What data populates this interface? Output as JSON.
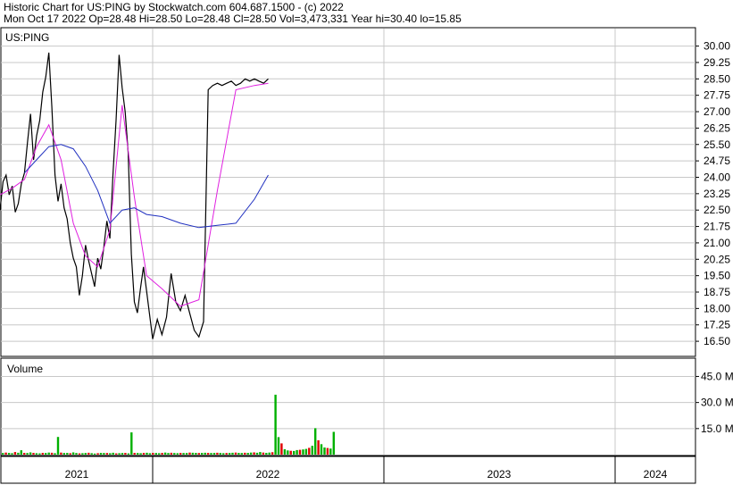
{
  "header": {
    "line1": "Historic Chart for US:PING by Stockwatch.com 604.687.1500 - (c) 2022",
    "line2": "Mon Oct 17 2022  Op=28.48  Hi=28.50  Lo=28.48  Cl=28.50  Vol=3,473,331  Year hi=30.40  lo=15.85"
  },
  "colors": {
    "price": "#000000",
    "ma_short": "#e020e0",
    "ma_long": "#2030c0",
    "grid": "#c8c8c8",
    "vol_up": "#00b000",
    "vol_down": "#e00000"
  },
  "chart_data": [
    {
      "type": "line",
      "title": "US:PING",
      "ylim": [
        15.85,
        30.8
      ],
      "y_ticks": [
        "30.00",
        "29.25",
        "28.50",
        "27.75",
        "27.00",
        "26.25",
        "25.50",
        "24.75",
        "24.00",
        "23.25",
        "22.50",
        "21.75",
        "21.00",
        "20.25",
        "19.50",
        "18.75",
        "18.00",
        "17.25",
        "16.50"
      ],
      "grid": true,
      "series": [
        {
          "name": "",
          "values": [
            [
              2021.0,
              22.5
            ],
            [
              2021.02,
              23.8
            ],
            [
              2021.04,
              24.1
            ],
            [
              2021.06,
              23.2
            ],
            [
              2021.08,
              23.6
            ],
            [
              2021.1,
              22.4
            ],
            [
              2021.12,
              22.8
            ],
            [
              2021.14,
              23.7
            ],
            [
              2021.16,
              24.2
            ],
            [
              2021.18,
              25.6
            ],
            [
              2021.2,
              26.9
            ],
            [
              2021.22,
              24.8
            ],
            [
              2021.24,
              25.9
            ],
            [
              2021.26,
              26.6
            ],
            [
              2021.28,
              27.9
            ],
            [
              2021.3,
              28.6
            ],
            [
              2021.32,
              29.7
            ],
            [
              2021.34,
              27.2
            ],
            [
              2021.36,
              24.1
            ],
            [
              2021.38,
              22.9
            ],
            [
              2021.4,
              23.7
            ],
            [
              2021.42,
              22.6
            ],
            [
              2021.44,
              22.1
            ],
            [
              2021.46,
              21.0
            ],
            [
              2021.48,
              20.3
            ],
            [
              2021.5,
              19.9
            ],
            [
              2021.52,
              18.6
            ],
            [
              2021.54,
              19.5
            ],
            [
              2021.56,
              20.9
            ],
            [
              2021.58,
              20.2
            ],
            [
              2021.6,
              19.6
            ],
            [
              2021.62,
              19.0
            ],
            [
              2021.64,
              20.3
            ],
            [
              2021.66,
              19.8
            ],
            [
              2021.68,
              20.8
            ],
            [
              2021.7,
              22.0
            ],
            [
              2021.72,
              21.2
            ],
            [
              2021.74,
              24.1
            ],
            [
              2021.76,
              26.6
            ],
            [
              2021.78,
              29.6
            ],
            [
              2021.8,
              28.1
            ],
            [
              2021.82,
              27.0
            ],
            [
              2021.84,
              25.1
            ],
            [
              2021.86,
              20.5
            ],
            [
              2021.88,
              18.3
            ],
            [
              2021.9,
              17.8
            ],
            [
              2021.92,
              18.9
            ],
            [
              2021.94,
              19.9
            ],
            [
              2021.96,
              18.8
            ],
            [
              2021.98,
              17.7
            ],
            [
              2022.0,
              16.6
            ],
            [
              2022.02,
              17.5
            ],
            [
              2022.04,
              16.8
            ],
            [
              2022.06,
              17.6
            ],
            [
              2022.08,
              19.6
            ],
            [
              2022.1,
              18.3
            ],
            [
              2022.12,
              17.9
            ],
            [
              2022.14,
              18.6
            ],
            [
              2022.16,
              17.8
            ],
            [
              2022.18,
              17.0
            ],
            [
              2022.2,
              16.7
            ],
            [
              2022.22,
              17.4
            ],
            [
              2022.24,
              28.0
            ],
            [
              2022.26,
              28.2
            ],
            [
              2022.28,
              28.3
            ],
            [
              2022.3,
              28.2
            ],
            [
              2022.32,
              28.3
            ],
            [
              2022.34,
              28.4
            ],
            [
              2022.36,
              28.2
            ],
            [
              2022.38,
              28.3
            ],
            [
              2022.4,
              28.5
            ],
            [
              2022.42,
              28.4
            ],
            [
              2022.44,
              28.5
            ],
            [
              2022.46,
              28.4
            ],
            [
              2022.48,
              28.3
            ],
            [
              2022.5,
              28.5
            ]
          ]
        },
        {
          "name": "",
          "values": [
            [
              2021.0,
              23.2
            ],
            [
              2021.08,
              23.5
            ],
            [
              2021.16,
              23.9
            ],
            [
              2021.24,
              25.4
            ],
            [
              2021.32,
              26.4
            ],
            [
              2021.4,
              24.8
            ],
            [
              2021.48,
              21.9
            ],
            [
              2021.56,
              20.4
            ],
            [
              2021.64,
              19.9
            ],
            [
              2021.72,
              21.6
            ],
            [
              2021.8,
              27.3
            ],
            [
              2021.88,
              23.1
            ],
            [
              2021.96,
              19.5
            ],
            [
              2022.04,
              18.9
            ],
            [
              2022.12,
              18.1
            ],
            [
              2022.2,
              18.4
            ],
            [
              2022.28,
              23.4
            ],
            [
              2022.36,
              28.0
            ],
            [
              2022.44,
              28.2
            ],
            [
              2022.5,
              28.3
            ]
          ]
        },
        {
          "name": "",
          "values": [
            [
              2021.16,
              24.2
            ],
            [
              2021.24,
              24.8
            ],
            [
              2021.32,
              25.4
            ],
            [
              2021.4,
              25.5
            ],
            [
              2021.48,
              25.3
            ],
            [
              2021.56,
              24.5
            ],
            [
              2021.64,
              23.4
            ],
            [
              2021.72,
              21.9
            ],
            [
              2021.8,
              22.5
            ],
            [
              2021.88,
              22.6
            ],
            [
              2021.96,
              22.3
            ],
            [
              2022.04,
              22.2
            ],
            [
              2022.12,
              21.9
            ],
            [
              2022.2,
              21.7
            ],
            [
              2022.28,
              21.8
            ],
            [
              2022.36,
              21.9
            ],
            [
              2022.44,
              23.0
            ],
            [
              2022.5,
              24.1
            ]
          ]
        }
      ]
    },
    {
      "type": "bar",
      "title": "Volume",
      "ylim": [
        0,
        55
      ],
      "y_ticks": [
        "45.0 M",
        "30.0 M",
        "15.0 M"
      ],
      "values": [
        0.9,
        1.2,
        1.0,
        0.8,
        1.5,
        1.1,
        2.5,
        1.0,
        0.9,
        1.3,
        1.0,
        0.8,
        0.7,
        1.0,
        0.9,
        1.2,
        1.1,
        0.8,
        10.2,
        1.2,
        0.9,
        1.0,
        0.8,
        1.3,
        0.9,
        0.7,
        0.8,
        0.9,
        1.1,
        0.8,
        0.6,
        0.8,
        1.0,
        0.9,
        0.9,
        0.8,
        1.1,
        0.7,
        0.8,
        0.9,
        1.0,
        0.7,
        12.8,
        1.0,
        0.9,
        0.8,
        1.0,
        1.1,
        0.8,
        1.0,
        0.9,
        0.8,
        1.0,
        1.2,
        0.9,
        1.1,
        0.9,
        0.8,
        1.0,
        0.9,
        0.9,
        1.2,
        1.1,
        1.0,
        0.9,
        1.0,
        1.1,
        1.0,
        0.9,
        1.0,
        1.1,
        1.0,
        0.8,
        0.9,
        1.0,
        1.1,
        1.2,
        1.0,
        0.9,
        1.1,
        1.0,
        1.2,
        1.3,
        1.1,
        1.5,
        1.2,
        1.0,
        1.2,
        1.4,
        34.5,
        10.1,
        6.5,
        3.1,
        2.4,
        2.2,
        2.1,
        2.6,
        2.8,
        3.0,
        3.3,
        3.9,
        5.1,
        15.2,
        8.3,
        6.0,
        4.1,
        3.8,
        3.5,
        13.1
      ]
    }
  ],
  "x_axis": {
    "labels": [
      "2021",
      "2022",
      "2023",
      "2024"
    ]
  }
}
